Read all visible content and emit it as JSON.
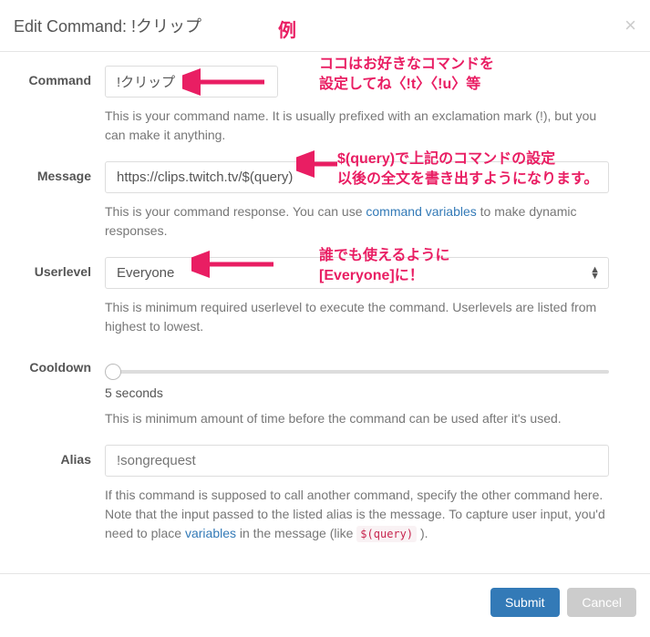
{
  "header": {
    "title": "Edit Command: !クリップ"
  },
  "form": {
    "command": {
      "label": "Command",
      "value": "!クリップ",
      "help": "This is your command name. It is usually prefixed with an exclamation mark (!), but you can make it anything."
    },
    "message": {
      "label": "Message",
      "value": "https://clips.twitch.tv/$(query)",
      "help_before": "This is your command response. You can use ",
      "help_link": "command variables",
      "help_after": " to make dynamic responses."
    },
    "userlevel": {
      "label": "Userlevel",
      "value": "Everyone",
      "help": "This is minimum required userlevel to execute the command. Userlevels are listed from highest to lowest."
    },
    "cooldown": {
      "label": "Cooldown",
      "value_text": "5 seconds",
      "help": "This is minimum amount of time before the command can be used after it's used."
    },
    "alias": {
      "label": "Alias",
      "placeholder": "!songrequest",
      "help_before": "If this command is supposed to call another command, specify the other command here. Note that the input passed to the listed alias is the message. To capture user input, you'd need to place ",
      "help_link": "variables",
      "help_mid": " in the message (like ",
      "code": "$(query)",
      "help_after": " )."
    }
  },
  "footer": {
    "submit": "Submit",
    "cancel": "Cancel"
  },
  "annotations": {
    "example": "例",
    "command_note": "ココはお好きなコマンドを\n設定してね〈!t〉〈!u〉等",
    "message_note": "$(query)で上記のコマンドの設定\n以後の全文を書き出すようになります。",
    "userlevel_note": "誰でも使えるように\n[Everyone]に！"
  }
}
